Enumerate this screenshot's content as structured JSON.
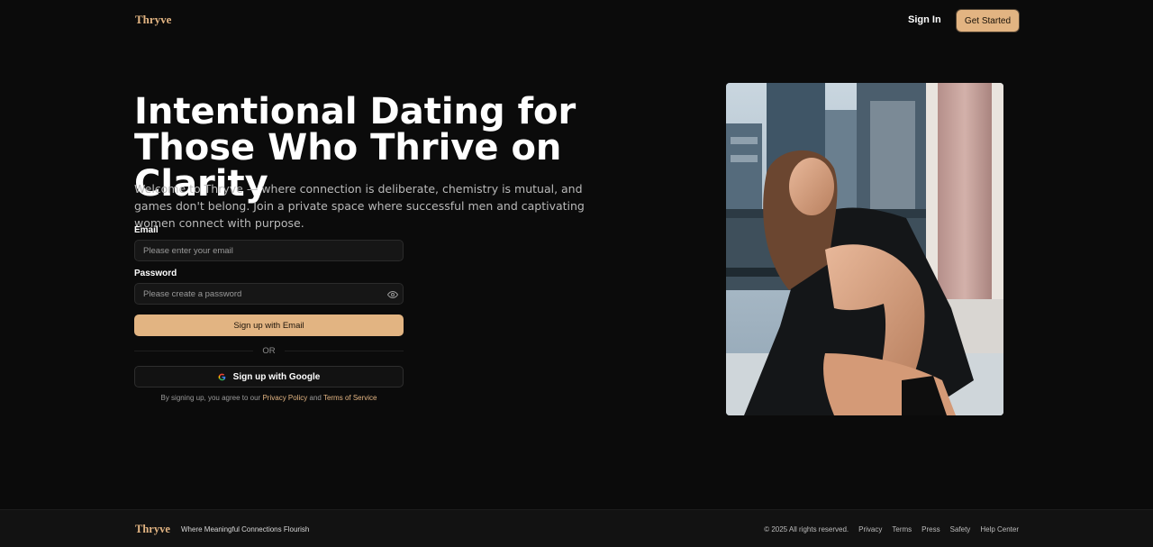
{
  "header": {
    "logo": "Thryve",
    "signin_label": "Sign In",
    "get_started_label": "Get Started"
  },
  "hero": {
    "title": "Intentional Dating for Those Who Thrive on Clarity",
    "subtitle": "Welcome to Thryve — where connection is deliberate, chemistry is mutual, and games don't belong. Join a private space where successful men and captivating women connect with purpose."
  },
  "form": {
    "email_label": "Email",
    "email_placeholder": "Please enter your email",
    "password_label": "Password",
    "password_placeholder": "Please create a password",
    "email_button": "Sign up with Email",
    "or_text": "OR",
    "google_button": "Sign up with Google",
    "terms_prefix": "By signing up, you agree to our",
    "privacy_link": "Privacy Policy",
    "and_text": "and",
    "terms_link": "Terms of Service"
  },
  "footer": {
    "logo": "Thryve",
    "tagline": "Where Meaningful Connections Flourish",
    "copyright": "© 2025 All rights reserved.",
    "links": [
      "Privacy",
      "Terms",
      "Press",
      "Safety",
      "Help Center"
    ]
  },
  "icons": {
    "password_toggle": "eye-icon",
    "google": "google-g-icon"
  },
  "colors": {
    "accent": "#e2b482",
    "background": "#0b0b0b",
    "footer_background": "#121212"
  }
}
